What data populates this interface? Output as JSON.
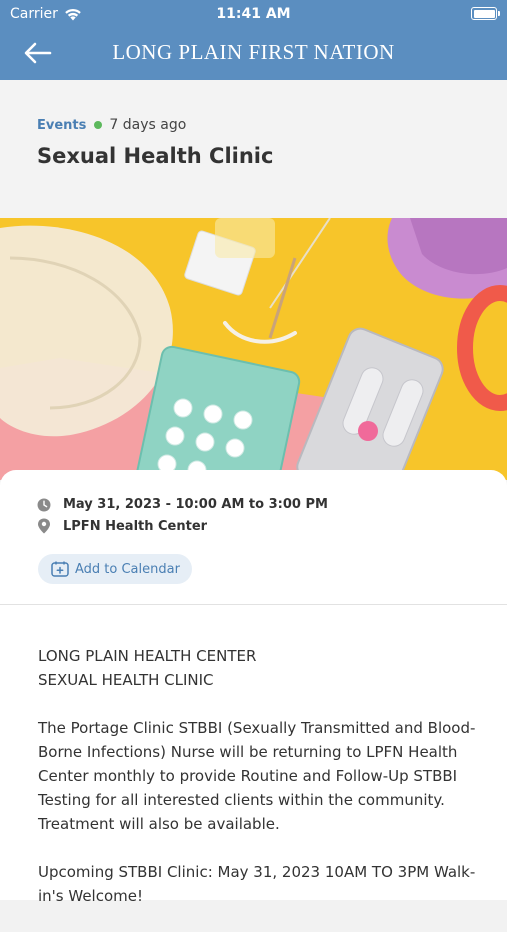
{
  "status": {
    "carrier": "Carrier",
    "time": "11:41 AM"
  },
  "nav": {
    "title": "LONG PLAIN FIRST NATION"
  },
  "event": {
    "category": "Events",
    "posted": "7 days ago",
    "title": "Sexual Health Clinic",
    "datetime": "May 31, 2023 - 10:00 AM to 3:00 PM",
    "location": "LPFN Health Center",
    "calendar_label": "Add to Calendar"
  },
  "body": {
    "heading_line1": "LONG PLAIN HEALTH CENTER",
    "heading_line2": "SEXUAL HEALTH CLINIC",
    "paragraph": "The Portage Clinic STBBI (Sexually Transmitted and Blood-Borne Infections) Nurse will be returning to LPFN Health Center monthly to provide Routine and Follow-Up STBBI Testing for all interested clients within the community. Treatment will also be available.",
    "upcoming": "Upcoming STBBI Clinic: May 31, 2023 10AM TO 3PM Walk-in's Welcome!"
  },
  "colors": {
    "header": "#5b8ec0",
    "accent": "#4a7fb3",
    "status_dot": "#5cb85c"
  },
  "icons": {
    "back": "arrow-left-icon",
    "wifi": "wifi-icon",
    "battery": "battery-icon",
    "clock": "clock-icon",
    "location": "location-pin-icon",
    "calendar": "calendar-plus-icon"
  }
}
